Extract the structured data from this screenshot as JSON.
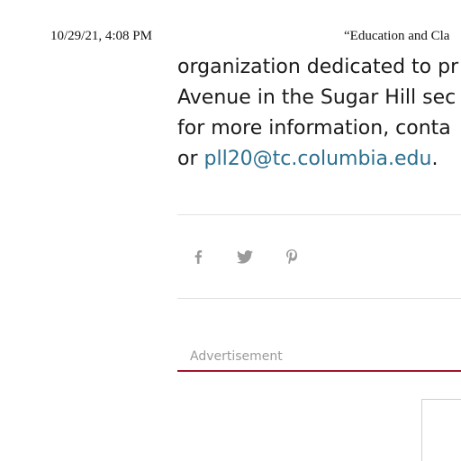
{
  "print_header": {
    "date": "10/29/21, 4:08 PM",
    "title": "“Education and Cla"
  },
  "article": {
    "line1": "organization dedicated to pr",
    "line2": "Avenue in the Sugar Hill sec",
    "line3": "for more information, conta",
    "line4_prefix": "or ",
    "email": "pll20@tc.columbia.edu",
    "line4_suffix": "."
  },
  "share": {
    "icons": [
      "facebook-icon",
      "twitter-icon",
      "pinterest-icon"
    ],
    "icon_color": "#9a9a9a"
  },
  "advertisement": {
    "label": "Advertisement",
    "accent_color": "#a3152f"
  },
  "colors": {
    "link": "#2a6f8f",
    "text": "#1b1b1b"
  }
}
